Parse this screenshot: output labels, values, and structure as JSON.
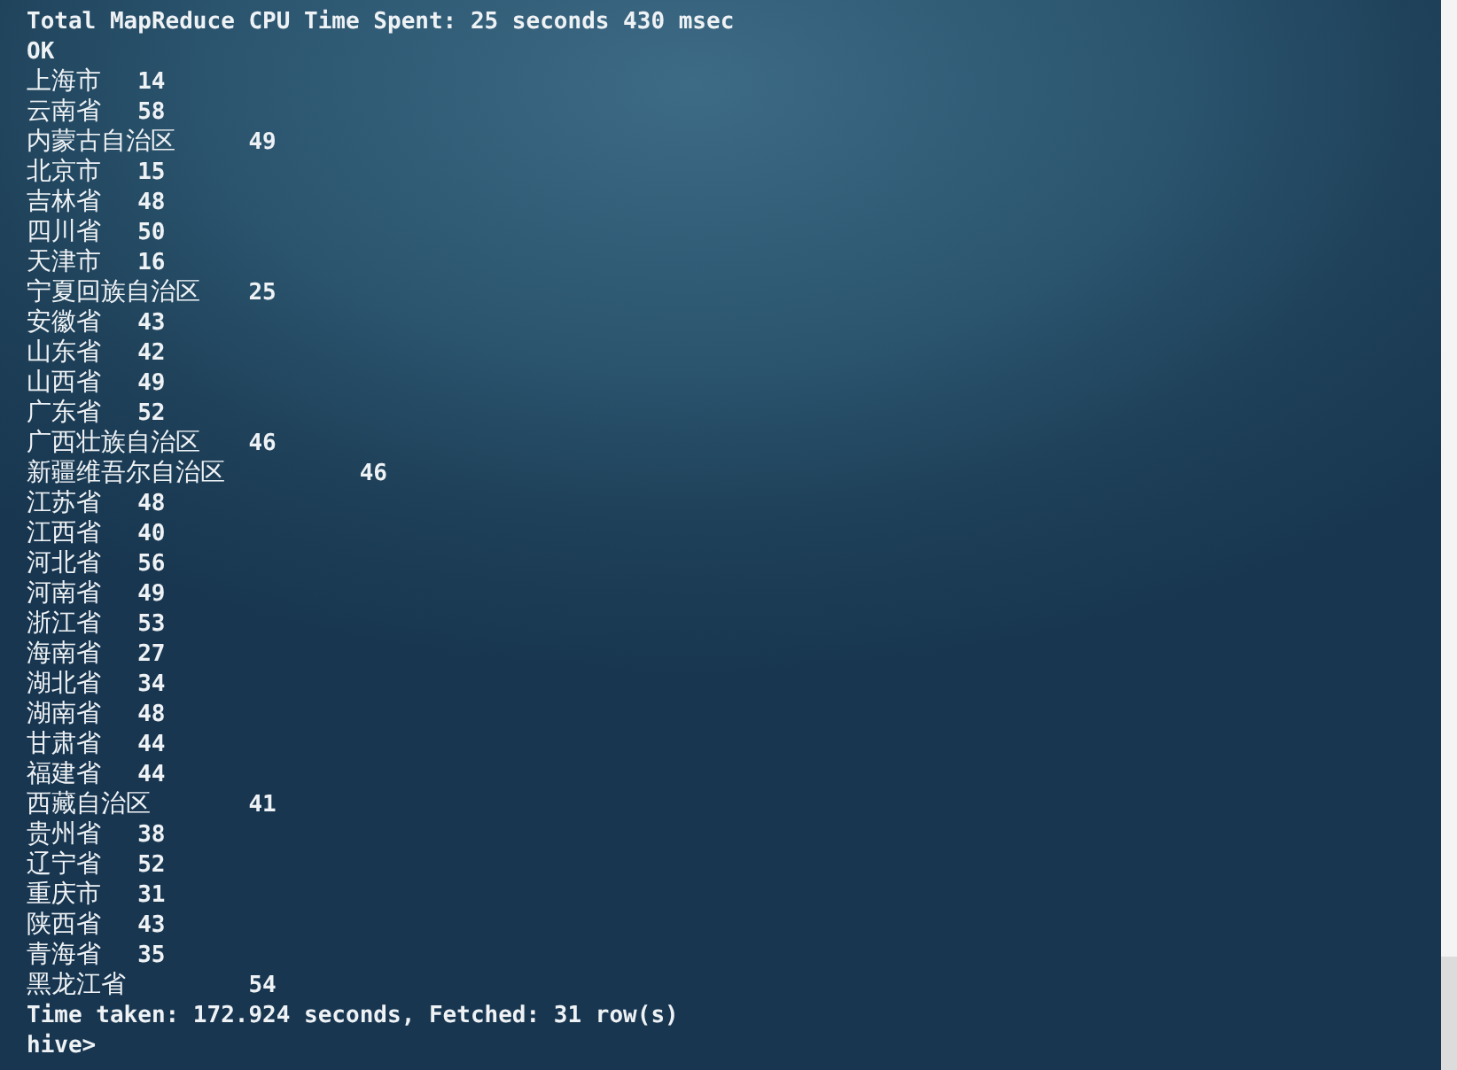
{
  "terminal": {
    "header_lines": [
      "Total MapReduce CPU Time Spent: 25 seconds 430 msec",
      "OK"
    ],
    "rows": [
      {
        "region": "上海市",
        "count": "14"
      },
      {
        "region": "云南省",
        "count": "58"
      },
      {
        "region": "内蒙古自治区",
        "count": "49"
      },
      {
        "region": "北京市",
        "count": "15"
      },
      {
        "region": "吉林省",
        "count": "48"
      },
      {
        "region": "四川省",
        "count": "50"
      },
      {
        "region": "天津市",
        "count": "16"
      },
      {
        "region": "宁夏回族自治区",
        "count": "25"
      },
      {
        "region": "安徽省",
        "count": "43"
      },
      {
        "region": "山东省",
        "count": "42"
      },
      {
        "region": "山西省",
        "count": "49"
      },
      {
        "region": "广东省",
        "count": "52"
      },
      {
        "region": "广西壮族自治区",
        "count": "46"
      },
      {
        "region": "新疆维吾尔自治区",
        "count": "46"
      },
      {
        "region": "江苏省",
        "count": "48"
      },
      {
        "region": "江西省",
        "count": "40"
      },
      {
        "region": "河北省",
        "count": "56"
      },
      {
        "region": "河南省",
        "count": "49"
      },
      {
        "region": "浙江省",
        "count": "53"
      },
      {
        "region": "海南省",
        "count": "27"
      },
      {
        "region": "湖北省",
        "count": "34"
      },
      {
        "region": "湖南省",
        "count": "48"
      },
      {
        "region": "甘肃省",
        "count": "44"
      },
      {
        "region": "福建省",
        "count": "44"
      },
      {
        "region": "西藏自治区",
        "count": "41"
      },
      {
        "region": "贵州省",
        "count": "38"
      },
      {
        "region": "辽宁省",
        "count": "52"
      },
      {
        "region": "重庆市",
        "count": "31"
      },
      {
        "region": "陕西省",
        "count": "43"
      },
      {
        "region": "青海省",
        "count": "35"
      },
      {
        "region": "黑龙江省",
        "count": "54"
      }
    ],
    "footer_line": "Time taken: 172.924 seconds, Fetched: 31 row(s)",
    "prompt": "hive>"
  }
}
